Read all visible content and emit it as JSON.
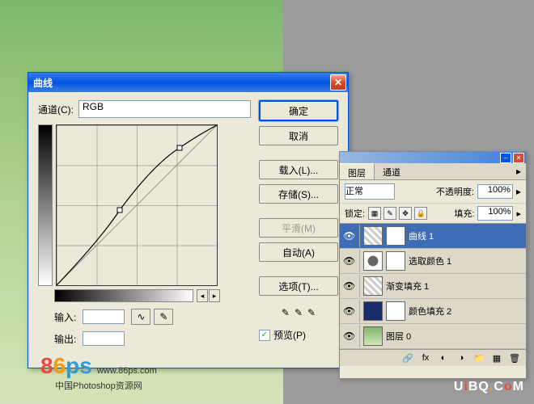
{
  "curves": {
    "title": "曲线",
    "channel_label": "通道(C):",
    "channel_value": "RGB",
    "input_label": "输入:",
    "output_label": "输出:",
    "buttons": {
      "ok": "确定",
      "cancel": "取消",
      "load": "载入(L)...",
      "save": "存储(S)...",
      "smooth": "平滑(M)",
      "auto": "自动(A)",
      "options": "选项(T)..."
    },
    "preview_label": "预览(P)",
    "preview_checked": "✓"
  },
  "layers": {
    "tabs": {
      "layers": "图层",
      "channels": "通道"
    },
    "blend_mode": "正常",
    "opacity_label": "不透明度:",
    "opacity_value": "100%",
    "lock_label": "锁定:",
    "fill_label": "填充:",
    "fill_value": "100%",
    "items": [
      {
        "name": "曲线 1"
      },
      {
        "name": "选取颜色 1"
      },
      {
        "name": "渐变填充 1"
      },
      {
        "name": "颜色填充 2"
      },
      {
        "name": "图层 0"
      }
    ]
  },
  "watermark": {
    "brand": "86ps",
    "url": "www.86ps.com",
    "text": "中国Photoshop资源网"
  },
  "uibq": "UiBQ.CoM",
  "chart_data": {
    "type": "line",
    "title": "曲线",
    "xlabel": "输入",
    "ylabel": "输出",
    "xlim": [
      0,
      255
    ],
    "ylim": [
      0,
      255
    ],
    "series": [
      {
        "name": "RGB",
        "x": [
          0,
          100,
          195,
          255
        ],
        "y": [
          0,
          120,
          218,
          255
        ]
      }
    ]
  }
}
